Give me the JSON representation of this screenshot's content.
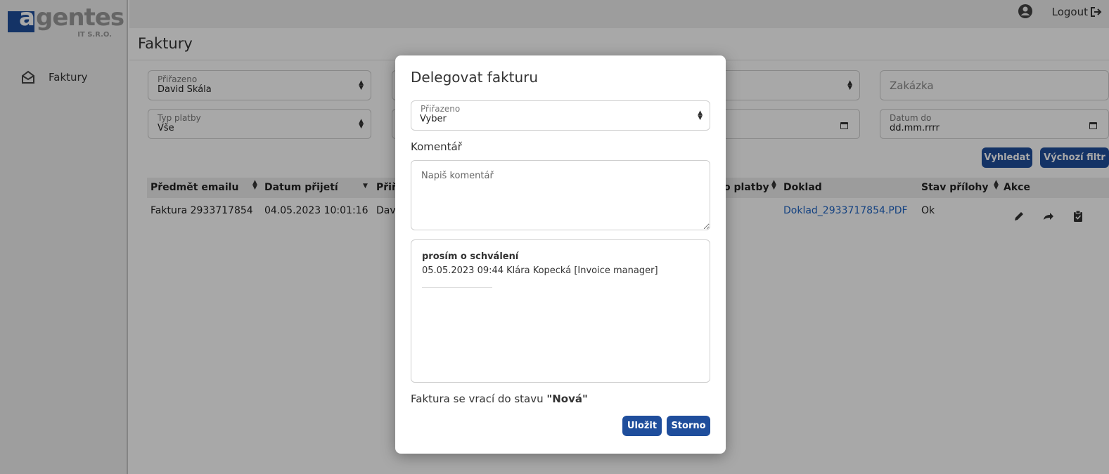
{
  "logo": {
    "main": "agentes",
    "first_letter": "a",
    "rest": "gentes",
    "sub": "IT S.R.O."
  },
  "sidebar": {
    "items": [
      {
        "label": "Faktury",
        "icon": "envelope-open-icon"
      }
    ]
  },
  "topbar": {
    "logout_label": "Logout"
  },
  "page": {
    "title": "Faktury"
  },
  "filters": {
    "assigned": {
      "label": "Přiřazeno",
      "value": "David Skála"
    },
    "payment_type": {
      "label": "Typ platby",
      "value": "Vše"
    },
    "contract": {
      "placeholder": "Zakázka"
    },
    "date_to": {
      "label": "Datum do",
      "value": "dd.mm.rrrr"
    },
    "search_button": "Vyhledat",
    "default_filter_button": "Výchozí filtr"
  },
  "table": {
    "headers": {
      "subject": "Předmět emailu",
      "received": "Datum přijetí",
      "assigned_partial": "Přiř",
      "payment_partial": "o platby",
      "document": "Doklad",
      "attachment_status": "Stav přílohy",
      "actions": "Akce"
    },
    "rows": [
      {
        "subject": "Faktura 2933717854",
        "received": "04.05.2023 10:01:16",
        "assigned_partial": "Dav",
        "document": "Doklad_2933717854.PDF",
        "attachment_status": "Ok"
      }
    ]
  },
  "modal": {
    "title": "Delegovat fakturu",
    "assigned": {
      "label": "Přiřazeno",
      "value": "Vyber"
    },
    "comment_label": "Komentář",
    "comment_placeholder": "Napiš komentář",
    "history": [
      {
        "title": "prosím o schválení",
        "meta": "05.05.2023 09:44 Klára Kopecká [Invoice manager]"
      }
    ],
    "status_text": "Faktura se vrací do stavu",
    "status_value": "\"Nová\"",
    "save_button": "Uložit",
    "cancel_button": "Storno"
  },
  "colors": {
    "primary": "#1f4e9c",
    "link": "#1f64c4"
  }
}
